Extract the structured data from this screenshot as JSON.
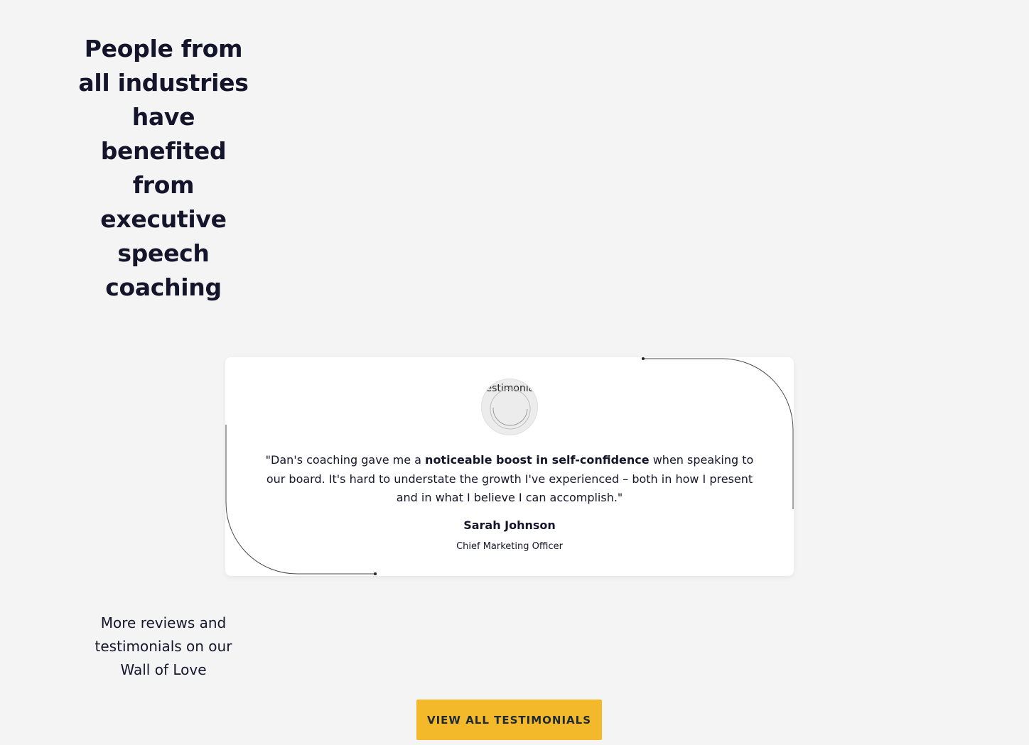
{
  "section": {
    "heading": "People from all industries have benefited from executive speech coaching"
  },
  "testimonial": {
    "avatar_alt": "testimonial",
    "quote_before": "\"Dan's coaching gave me a ",
    "quote_bold": "noticeable boost in self-confidence",
    "quote_after": " when speaking to our board. It's hard to understate the growth I've experienced – both in how I present and in what I believe I can accomplish.\"",
    "author_name": "Sarah Johnson",
    "author_role": "Chief Marketing Officer"
  },
  "more_reviews": {
    "text": "More reviews and testimonials on our Wall of Love"
  },
  "cta": {
    "label": "VIEW ALL TESTIMONIALS",
    "color": "#f4b92b"
  }
}
